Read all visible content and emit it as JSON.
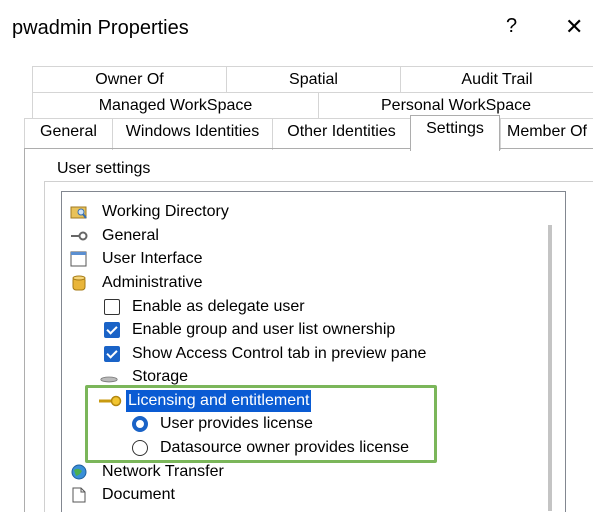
{
  "window": {
    "title": "pwadmin Properties",
    "help_label": "?",
    "close_label": "✕"
  },
  "tabs": {
    "row1": [
      "Owner Of",
      "Spatial",
      "Audit Trail"
    ],
    "row2": [
      "Managed WorkSpace",
      "Personal WorkSpace"
    ],
    "row3": [
      "General",
      "Windows Identities",
      "Other Identities",
      "Settings",
      "Member Of"
    ],
    "selected": "Settings"
  },
  "group": {
    "label": "User settings"
  },
  "tree": {
    "items": [
      {
        "label": "Working Directory",
        "icon": "folder-search-icon"
      },
      {
        "label": "General",
        "icon": "key-icon"
      },
      {
        "label": "User Interface",
        "icon": "window-icon"
      },
      {
        "label": "Administrative",
        "icon": "database-icon"
      },
      {
        "label": "Enable as delegate user",
        "checked": false
      },
      {
        "label": "Enable group and user list ownership",
        "checked": true
      },
      {
        "label": "Show Access Control tab in preview pane",
        "checked": true
      },
      {
        "label": "Storage",
        "icon": "storage-icon"
      },
      {
        "label": "Licensing and entitlement",
        "icon": "key-gold-icon",
        "selected": true
      },
      {
        "label": "User provides license",
        "radio_selected": true
      },
      {
        "label": "Datasource owner provides license",
        "radio_selected": false
      },
      {
        "label": "Network Transfer",
        "icon": "globe-icon"
      },
      {
        "label": "Document",
        "icon": "document-icon"
      }
    ]
  },
  "colors": {
    "selection": "#0a5bd3",
    "check_blue": "#1a63c7",
    "highlight_box": "#7bb65a"
  }
}
